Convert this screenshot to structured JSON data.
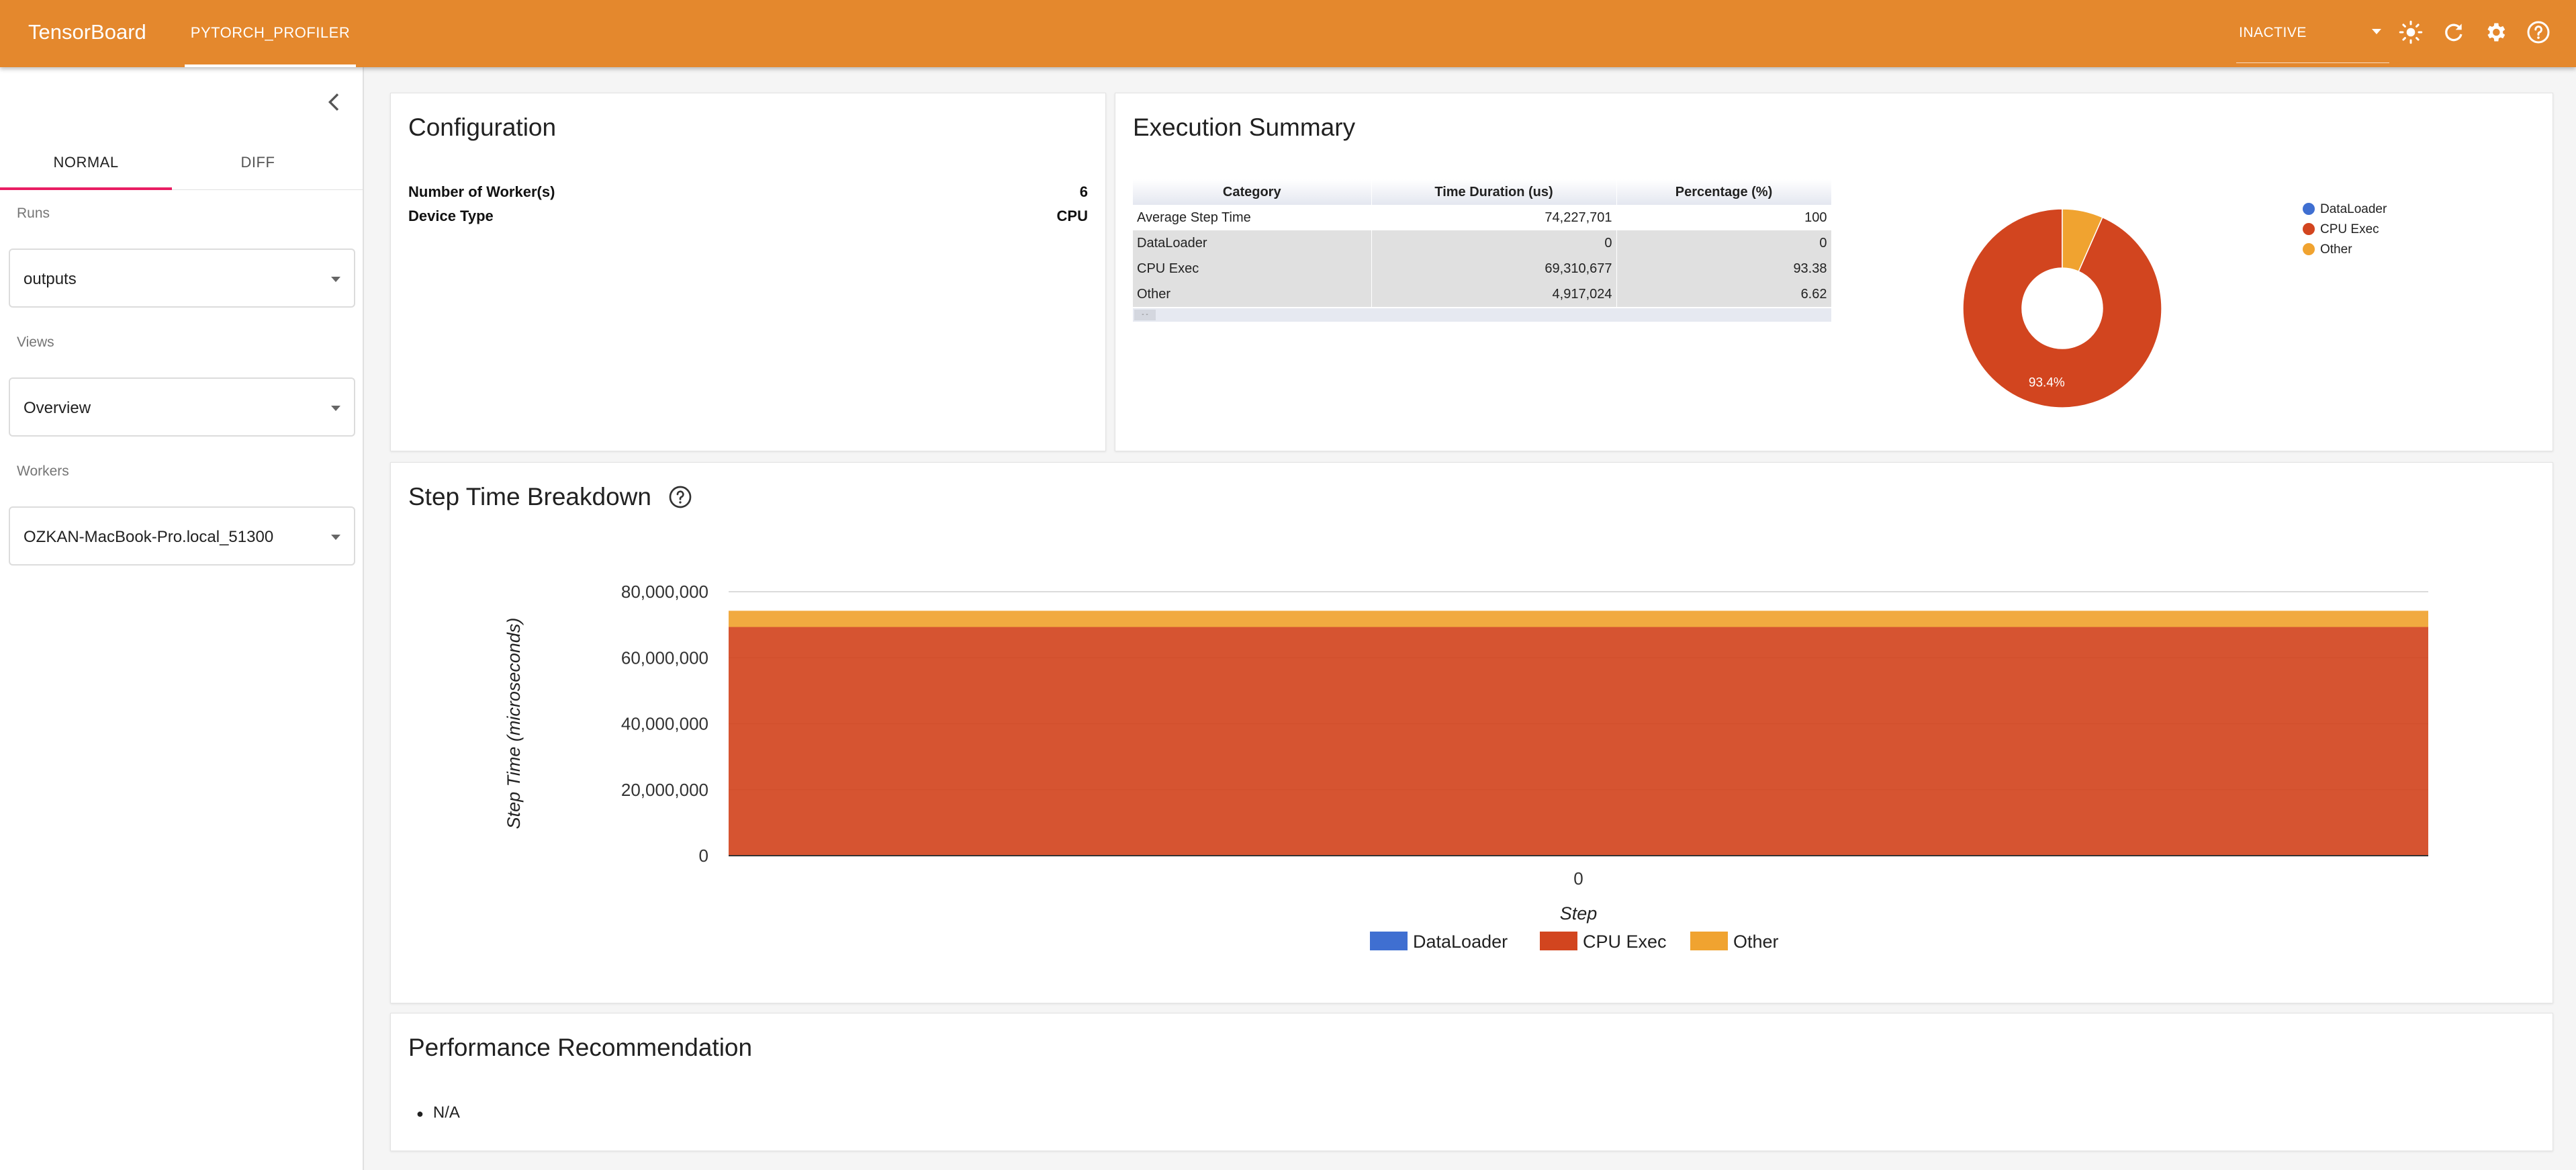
{
  "app": {
    "brand": "TensorBoard",
    "plugin_tab": "PYTORCH_PROFILER",
    "status_select": "INACTIVE",
    "accent_color": "#e4882d"
  },
  "sidebar": {
    "tabs": [
      "NORMAL",
      "DIFF"
    ],
    "active_tab": "NORMAL",
    "runs": {
      "label": "Runs",
      "value": "outputs"
    },
    "views": {
      "label": "Views",
      "value": "Overview"
    },
    "workers": {
      "label": "Workers",
      "value": "OZKAN-MacBook-Pro.local_51300"
    }
  },
  "configuration": {
    "title": "Configuration",
    "rows": [
      {
        "label": "Number of Worker(s)",
        "value": "6"
      },
      {
        "label": "Device Type",
        "value": "CPU"
      }
    ]
  },
  "execution_summary": {
    "title": "Execution Summary",
    "columns": [
      "Category",
      "Time Duration (us)",
      "Percentage (%)"
    ],
    "rows": [
      {
        "category": "Average Step Time",
        "duration": "74,227,701",
        "percentage": "100"
      },
      {
        "category": "DataLoader",
        "duration": "0",
        "percentage": "0"
      },
      {
        "category": "CPU Exec",
        "duration": "69,310,677",
        "percentage": "93.38"
      },
      {
        "category": "Other",
        "duration": "4,917,024",
        "percentage": "6.62"
      }
    ],
    "pager": "- -"
  },
  "chart_data": [
    {
      "type": "pie",
      "donut": true,
      "labels": [
        "DataLoader",
        "CPU Exec",
        "Other"
      ],
      "values": [
        0,
        93.38,
        6.62
      ],
      "colors": [
        "#3f6fd1",
        "#d2451f",
        "#f0a330"
      ],
      "slice_labels": [
        "",
        "93.4%",
        ""
      ],
      "legend_position": "right"
    },
    {
      "type": "area",
      "title": "Step Time Breakdown",
      "xlabel": "Step",
      "ylabel": "Step Time (microseconds)",
      "x": [
        "0"
      ],
      "ylim": [
        0,
        80000000
      ],
      "yticks": [
        "0",
        "20,000,000",
        "40,000,000",
        "60,000,000",
        "80,000,000"
      ],
      "stacked": true,
      "series": [
        {
          "name": "DataLoader",
          "values": [
            0
          ],
          "color": "#3f6fd1"
        },
        {
          "name": "CPU Exec",
          "values": [
            69310677
          ],
          "color": "#d2451f"
        },
        {
          "name": "Other",
          "values": [
            4917024
          ],
          "color": "#f0a330"
        }
      ],
      "legend_position": "bottom",
      "grid": true
    }
  ],
  "recommendation": {
    "title": "Performance Recommendation",
    "items": [
      "N/A"
    ]
  }
}
